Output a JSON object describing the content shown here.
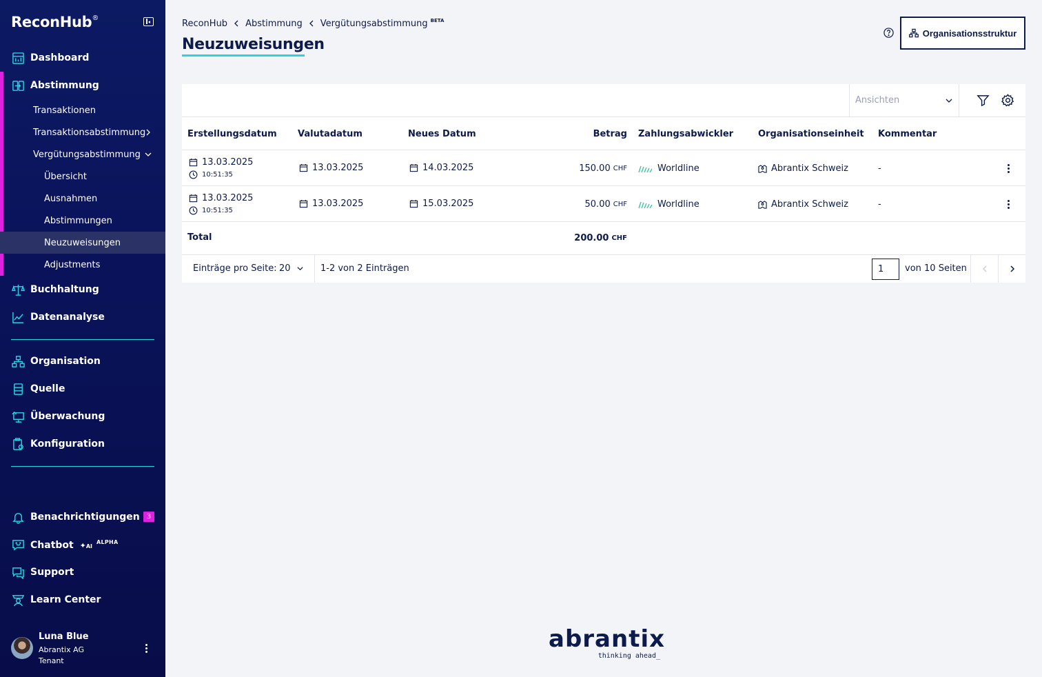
{
  "sidebar": {
    "brand": "ReconHub",
    "brand_mark": "®",
    "nav": {
      "dashboard": "Dashboard",
      "abstimmung": "Abstimmung",
      "transaktionen": "Transaktionen",
      "transaktionsabstimmung": "Transaktionsabstimmung",
      "verguetungsabstimmung": "Vergütungsabstimmung",
      "uebersicht": "Übersicht",
      "ausnahmen": "Ausnahmen",
      "abstimmungen": "Abstimmungen",
      "neuzuweisungen": "Neuzuweisungen",
      "adjustments": "Adjustments",
      "buchhaltung": "Buchhaltung",
      "datenanalyse": "Datenanalyse",
      "organisation": "Organisation",
      "quelle": "Quelle",
      "ueberwachung": "Überwachung",
      "konfiguration": "Konfiguration",
      "benachrichtigungen": "Benachrichtigungen",
      "notifications_count": "3",
      "chatbot": "Chatbot",
      "chatbot_ai": "AI",
      "chatbot_tag": "ALPHA",
      "support": "Support",
      "learn_center": "Learn Center"
    },
    "user": {
      "name": "Luna Blue",
      "org": "Abrantix AG",
      "role": "Tenant"
    }
  },
  "header": {
    "breadcrumb": [
      "ReconHub",
      "Abstimmung",
      "Vergütungsabstimmung"
    ],
    "breadcrumb_tag": "BETA",
    "title": "Neuzuweisungen",
    "org_button": "Organisationsstruktur"
  },
  "toolbar": {
    "views_placeholder": "Ansichten"
  },
  "table": {
    "columns": [
      "Erstellungsdatum",
      "Valutadatum",
      "Neues Datum",
      "Betrag",
      "Zahlungsabwickler",
      "Organisationseinheit",
      "Kommentar"
    ],
    "rows": [
      {
        "created_date": "13.03.2025",
        "created_time": "10:51:35",
        "value_date": "13.03.2025",
        "new_date": "14.03.2025",
        "amount": "150.00",
        "currency": "CHF",
        "processor": "Worldline",
        "org_unit": "Abrantix Schweiz",
        "comment": "-"
      },
      {
        "created_date": "13.03.2025",
        "created_time": "10:51:35",
        "value_date": "13.03.2025",
        "new_date": "15.03.2025",
        "amount": "50.00",
        "currency": "CHF",
        "processor": "Worldline",
        "org_unit": "Abrantix Schweiz",
        "comment": "-"
      }
    ],
    "total_label": "Total",
    "total_amount": "200.00",
    "total_currency": "CHF"
  },
  "pagination": {
    "per_page_label": "Einträge pro Seite:",
    "per_page_value": "20",
    "range_text": "1-2 von 2 Einträgen",
    "current_page": "1",
    "pages_text": "von 10 Seiten"
  },
  "footer": {
    "logo": "abrantix",
    "tagline": "thinking ahead_"
  },
  "colors": {
    "sidebar_bg": "#0a135a",
    "accent_cyan": "#25d4e0",
    "accent_magenta": "#e020e0",
    "text_dark": "#0d1b4c",
    "worldline_green": "#3fc7a0"
  }
}
